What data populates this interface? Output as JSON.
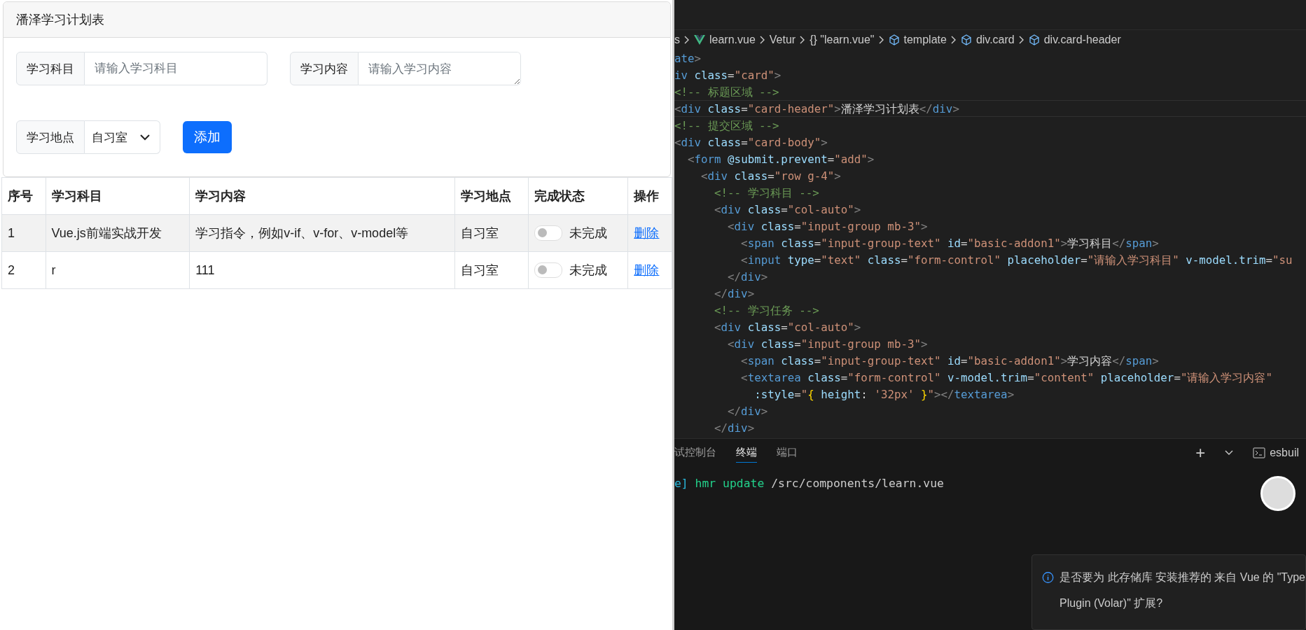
{
  "app": {
    "title": "潘泽学习计划表",
    "fields": [
      {
        "kind": "input",
        "label": "学习科目",
        "placeholder": "请输入学习科目"
      },
      {
        "kind": "textarea",
        "label": "学习内容",
        "placeholder": "请输入学习内容"
      },
      {
        "kind": "select",
        "label": "学习地点",
        "value": "自习室"
      }
    ],
    "add_button": "添加",
    "table": {
      "columns": [
        "序号",
        "学习科目",
        "学习内容",
        "学习地点",
        "完成状态",
        "操作"
      ],
      "rows": [
        {
          "index": "1",
          "subject": "Vue.js前端实战开发",
          "content": "学习指令，例如v-if、v-for、v-model等",
          "place": "自习室",
          "done": false,
          "status": "未完成",
          "action": "删除"
        },
        {
          "index": "2",
          "subject": "r",
          "content": "111",
          "place": "自习室",
          "done": false,
          "status": "未完成",
          "action": "删除"
        }
      ]
    }
  },
  "editor": {
    "breadcrumb": [
      "s",
      "learn.vue",
      "Vetur",
      "{} \"learn.vue\"",
      "template",
      "div.card",
      "div.card-header"
    ],
    "lines": [
      {
        "current": false,
        "tokens": [
          {
            "kind": "tag",
            "text": "ate"
          },
          {
            "kind": "punct",
            "text": ">"
          }
        ]
      },
      {
        "current": false,
        "tokens": [
          {
            "kind": "tag",
            "text": "iv "
          },
          {
            "kind": "attr",
            "text": "class"
          },
          {
            "kind": "text",
            "text": "="
          },
          {
            "kind": "string",
            "text": "\"card\""
          },
          {
            "kind": "punct",
            "text": ">"
          }
        ]
      },
      {
        "current": false,
        "tokens": [
          {
            "kind": "comment",
            "text": "<!-- 标题区域 -->"
          }
        ]
      },
      {
        "current": true,
        "tokens": [
          {
            "kind": "punct",
            "text": "<"
          },
          {
            "kind": "tag",
            "text": "div "
          },
          {
            "kind": "attr",
            "text": "class"
          },
          {
            "kind": "text",
            "text": "="
          },
          {
            "kind": "string",
            "text": "\"card-header\""
          },
          {
            "kind": "punct",
            "text": ">"
          },
          {
            "kind": "text",
            "text": "潘泽学习计划表"
          },
          {
            "kind": "punct",
            "text": "</"
          },
          {
            "kind": "tag",
            "text": "div"
          },
          {
            "kind": "punct",
            "text": ">"
          }
        ]
      },
      {
        "current": false,
        "tokens": [
          {
            "kind": "comment",
            "text": "<!-- 提交区域 -->"
          }
        ]
      },
      {
        "current": false,
        "tokens": [
          {
            "kind": "punct",
            "text": "<"
          },
          {
            "kind": "tag",
            "text": "div "
          },
          {
            "kind": "attr",
            "text": "class"
          },
          {
            "kind": "text",
            "text": "="
          },
          {
            "kind": "string",
            "text": "\"card-body\""
          },
          {
            "kind": "punct",
            "text": ">"
          }
        ]
      },
      {
        "current": false,
        "tokens": [
          {
            "kind": "punct",
            "text": "  <"
          },
          {
            "kind": "tag",
            "text": "form "
          },
          {
            "kind": "attr",
            "text": "@submit.prevent"
          },
          {
            "kind": "text",
            "text": "="
          },
          {
            "kind": "string",
            "text": "\"add\""
          },
          {
            "kind": "punct",
            "text": ">"
          }
        ]
      },
      {
        "current": false,
        "tokens": [
          {
            "kind": "punct",
            "text": "    <"
          },
          {
            "kind": "tag",
            "text": "div "
          },
          {
            "kind": "attr",
            "text": "class"
          },
          {
            "kind": "text",
            "text": "="
          },
          {
            "kind": "string",
            "text": "\"row g-4\""
          },
          {
            "kind": "punct",
            "text": ">"
          }
        ]
      },
      {
        "current": false,
        "tokens": [
          {
            "kind": "comment",
            "text": "      <!-- 学习科目 -->"
          }
        ]
      },
      {
        "current": false,
        "tokens": [
          {
            "kind": "punct",
            "text": "      <"
          },
          {
            "kind": "tag",
            "text": "div "
          },
          {
            "kind": "attr",
            "text": "class"
          },
          {
            "kind": "text",
            "text": "="
          },
          {
            "kind": "string",
            "text": "\"col-auto\""
          },
          {
            "kind": "punct",
            "text": ">"
          }
        ]
      },
      {
        "current": false,
        "tokens": [
          {
            "kind": "punct",
            "text": "        <"
          },
          {
            "kind": "tag",
            "text": "div "
          },
          {
            "kind": "attr",
            "text": "class"
          },
          {
            "kind": "text",
            "text": "="
          },
          {
            "kind": "string",
            "text": "\"input-group mb-3\""
          },
          {
            "kind": "punct",
            "text": ">"
          }
        ]
      },
      {
        "current": false,
        "tokens": [
          {
            "kind": "punct",
            "text": "          <"
          },
          {
            "kind": "tag",
            "text": "span "
          },
          {
            "kind": "attr",
            "text": "class"
          },
          {
            "kind": "text",
            "text": "="
          },
          {
            "kind": "string",
            "text": "\"input-group-text\" "
          },
          {
            "kind": "attr",
            "text": "id"
          },
          {
            "kind": "text",
            "text": "="
          },
          {
            "kind": "string",
            "text": "\"basic-addon1\""
          },
          {
            "kind": "punct",
            "text": ">"
          },
          {
            "kind": "text",
            "text": "学习科目"
          },
          {
            "kind": "punct",
            "text": "</"
          },
          {
            "kind": "tag",
            "text": "span"
          },
          {
            "kind": "punct",
            "text": ">"
          }
        ]
      },
      {
        "current": false,
        "tokens": [
          {
            "kind": "punct",
            "text": "          <"
          },
          {
            "kind": "tag",
            "text": "input "
          },
          {
            "kind": "attr",
            "text": "type"
          },
          {
            "kind": "text",
            "text": "="
          },
          {
            "kind": "string",
            "text": "\"text\" "
          },
          {
            "kind": "attr",
            "text": "class"
          },
          {
            "kind": "text",
            "text": "="
          },
          {
            "kind": "string",
            "text": "\"form-control\" "
          },
          {
            "kind": "attr",
            "text": "placeholder"
          },
          {
            "kind": "text",
            "text": "="
          },
          {
            "kind": "string",
            "text": "\"请输入学习科目\" "
          },
          {
            "kind": "attr",
            "text": "v-model.trim"
          },
          {
            "kind": "text",
            "text": "="
          },
          {
            "kind": "string",
            "text": "\"su"
          }
        ]
      },
      {
        "current": false,
        "tokens": [
          {
            "kind": "punct",
            "text": "        </"
          },
          {
            "kind": "tag",
            "text": "div"
          },
          {
            "kind": "punct",
            "text": ">"
          }
        ]
      },
      {
        "current": false,
        "tokens": [
          {
            "kind": "punct",
            "text": "      </"
          },
          {
            "kind": "tag",
            "text": "div"
          },
          {
            "kind": "punct",
            "text": ">"
          }
        ]
      },
      {
        "current": false,
        "tokens": [
          {
            "kind": "comment",
            "text": "      <!-- 学习任务 -->"
          }
        ]
      },
      {
        "current": false,
        "tokens": [
          {
            "kind": "punct",
            "text": "      <"
          },
          {
            "kind": "tag",
            "text": "div "
          },
          {
            "kind": "attr",
            "text": "class"
          },
          {
            "kind": "text",
            "text": "="
          },
          {
            "kind": "string",
            "text": "\"col-auto\""
          },
          {
            "kind": "punct",
            "text": ">"
          }
        ]
      },
      {
        "current": false,
        "tokens": [
          {
            "kind": "punct",
            "text": "        <"
          },
          {
            "kind": "tag",
            "text": "div "
          },
          {
            "kind": "attr",
            "text": "class"
          },
          {
            "kind": "text",
            "text": "="
          },
          {
            "kind": "string",
            "text": "\"input-group mb-3\""
          },
          {
            "kind": "punct",
            "text": ">"
          }
        ]
      },
      {
        "current": false,
        "tokens": [
          {
            "kind": "punct",
            "text": "          <"
          },
          {
            "kind": "tag",
            "text": "span "
          },
          {
            "kind": "attr",
            "text": "class"
          },
          {
            "kind": "text",
            "text": "="
          },
          {
            "kind": "string",
            "text": "\"input-group-text\" "
          },
          {
            "kind": "attr",
            "text": "id"
          },
          {
            "kind": "text",
            "text": "="
          },
          {
            "kind": "string",
            "text": "\"basic-addon1\""
          },
          {
            "kind": "punct",
            "text": ">"
          },
          {
            "kind": "text",
            "text": "学习内容"
          },
          {
            "kind": "punct",
            "text": "</"
          },
          {
            "kind": "tag",
            "text": "span"
          },
          {
            "kind": "punct",
            "text": ">"
          }
        ]
      },
      {
        "current": false,
        "tokens": [
          {
            "kind": "punct",
            "text": "          <"
          },
          {
            "kind": "tag",
            "text": "textarea "
          },
          {
            "kind": "attr",
            "text": "class"
          },
          {
            "kind": "text",
            "text": "="
          },
          {
            "kind": "string",
            "text": "\"form-control\" "
          },
          {
            "kind": "attr",
            "text": "v-model.trim"
          },
          {
            "kind": "text",
            "text": "="
          },
          {
            "kind": "string",
            "text": "\"content\" "
          },
          {
            "kind": "attr",
            "text": "placeholder"
          },
          {
            "kind": "text",
            "text": "="
          },
          {
            "kind": "string",
            "text": "\"请输入学习内容\""
          }
        ]
      },
      {
        "current": false,
        "tokens": [
          {
            "kind": "attr",
            "text": "            :style"
          },
          {
            "kind": "text",
            "text": "="
          },
          {
            "kind": "string",
            "text": "\""
          },
          {
            "kind": "brace",
            "text": "{ "
          },
          {
            "kind": "attr",
            "text": "height"
          },
          {
            "kind": "text",
            "text": ": "
          },
          {
            "kind": "string",
            "text": "'32px' "
          },
          {
            "kind": "brace",
            "text": "}"
          },
          {
            "kind": "string",
            "text": "\""
          },
          {
            "kind": "punct",
            "text": "></"
          },
          {
            "kind": "tag",
            "text": "textarea"
          },
          {
            "kind": "punct",
            "text": ">"
          }
        ]
      },
      {
        "current": false,
        "tokens": [
          {
            "kind": "punct",
            "text": "        </"
          },
          {
            "kind": "tag",
            "text": "div"
          },
          {
            "kind": "punct",
            "text": ">"
          }
        ]
      },
      {
        "current": false,
        "tokens": [
          {
            "kind": "punct",
            "text": "      </"
          },
          {
            "kind": "tag",
            "text": "div"
          },
          {
            "kind": "punct",
            "text": ">"
          }
        ]
      }
    ]
  },
  "panel": {
    "tabs": [
      {
        "label": "试控制台",
        "selected": false
      },
      {
        "label": "终端",
        "selected": true
      },
      {
        "label": "端口",
        "selected": false
      }
    ],
    "add": "+",
    "shell": "esbuil",
    "terminal": [
      {
        "kind": "bracket",
        "text": "e]"
      },
      {
        "kind": "command",
        "text": " hmr update"
      },
      {
        "kind": "path",
        "text": " /src/components/learn.vue"
      }
    ]
  },
  "notification": {
    "lines": [
      "是否要为 此存储库 安装推荐的 来自 Vue 的 \"Type",
      "Plugin (Volar)\" 扩展?"
    ]
  }
}
